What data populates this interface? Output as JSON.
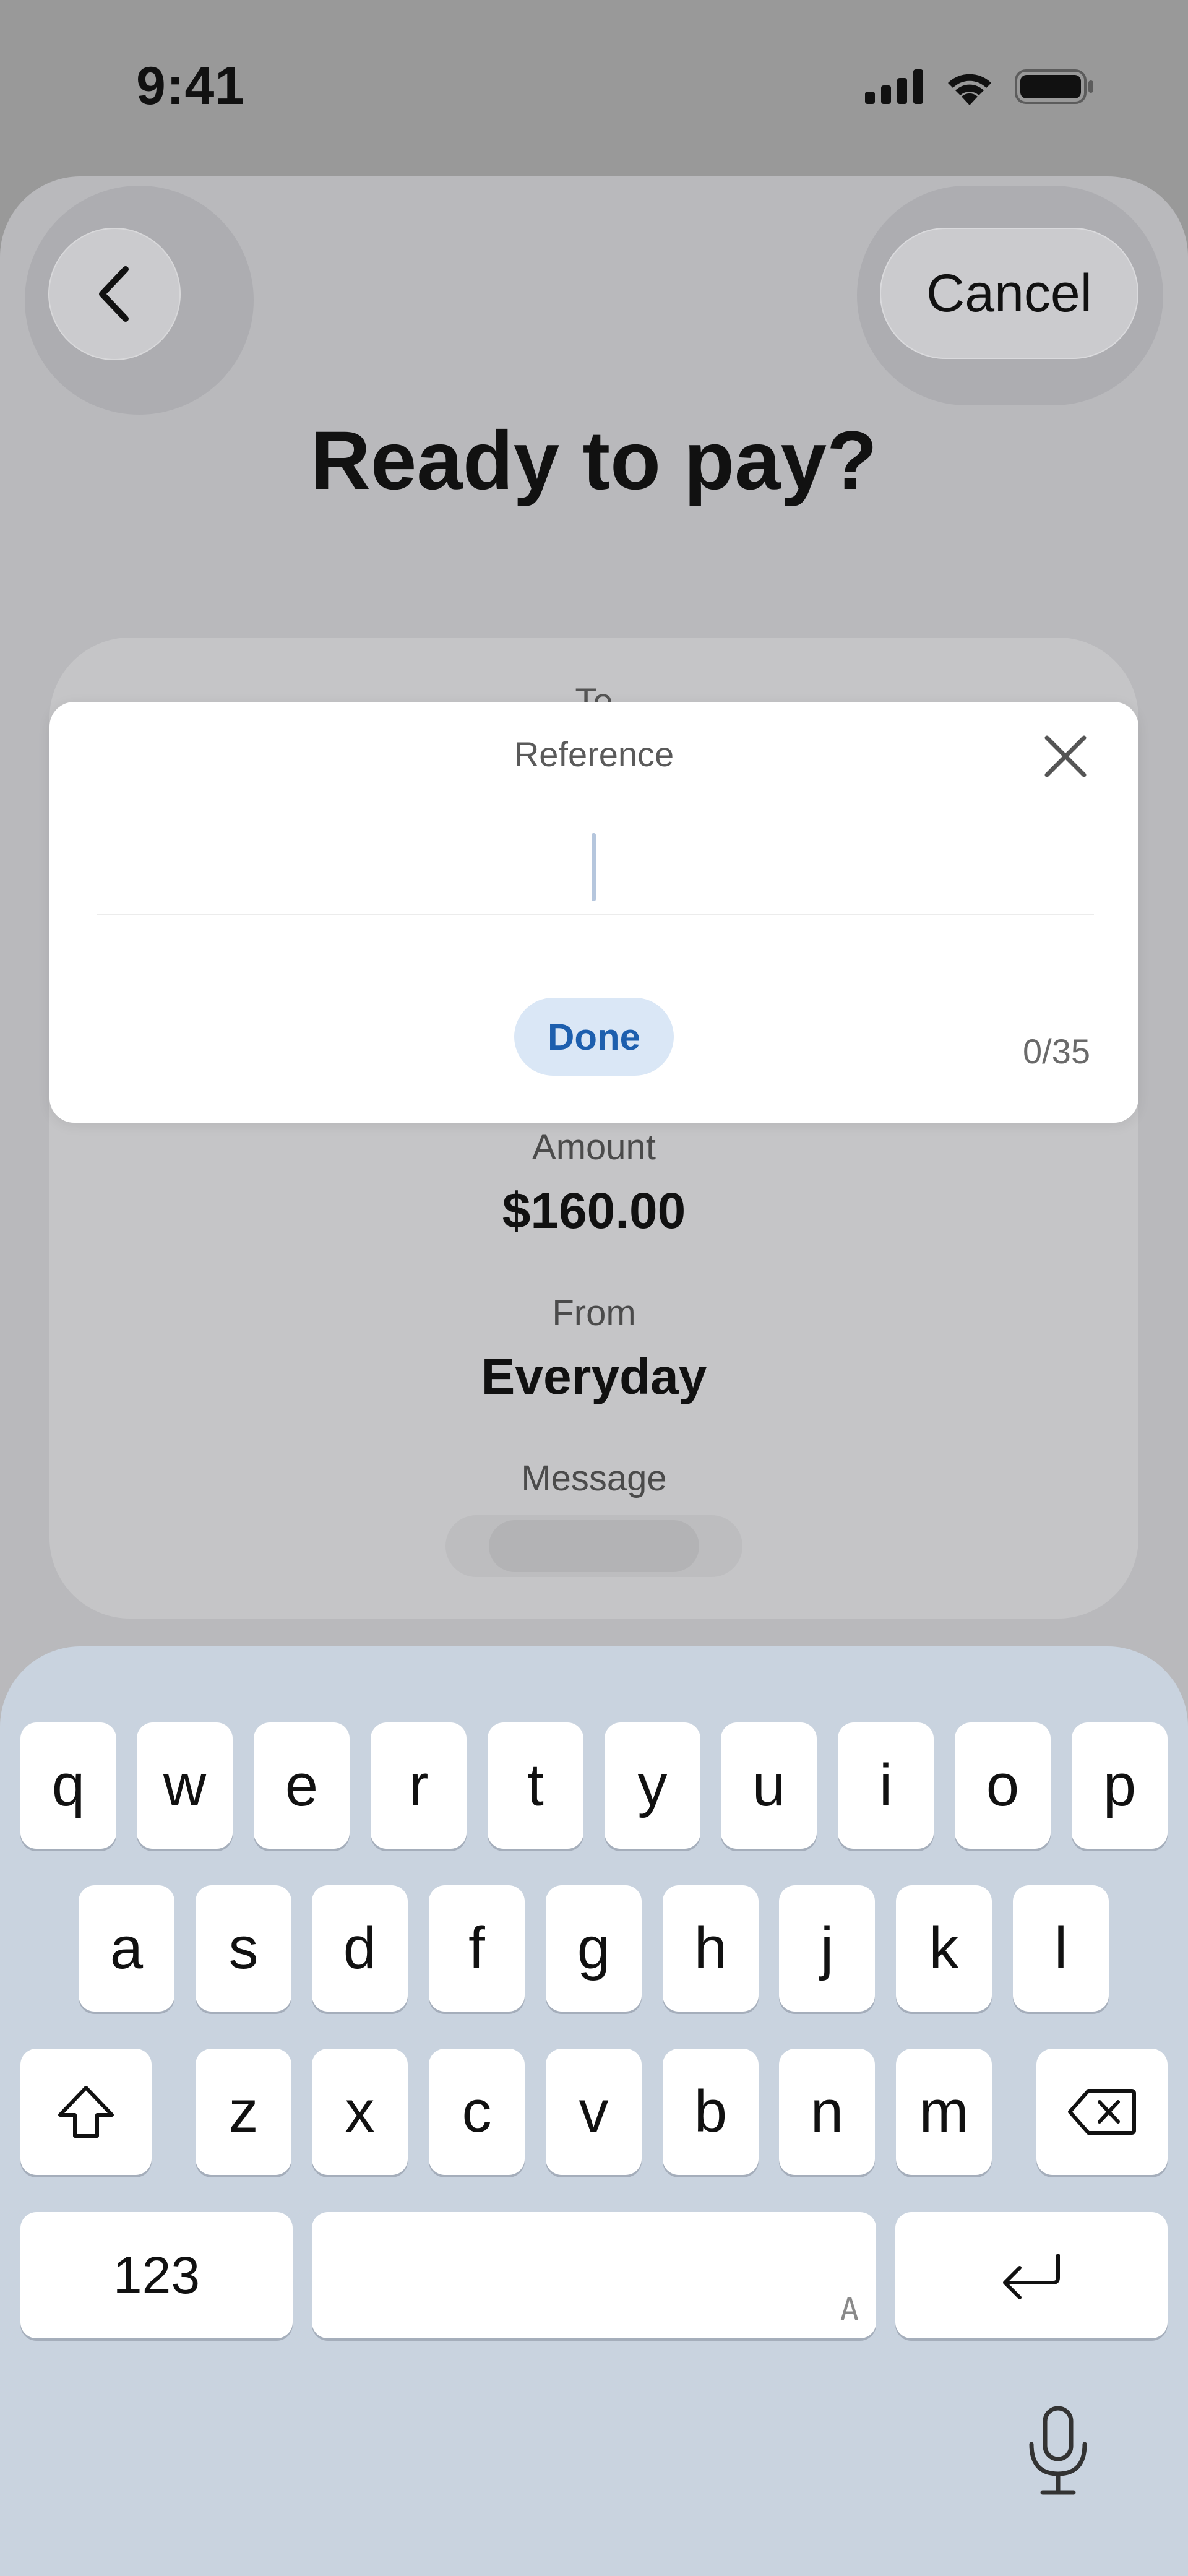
{
  "status_bar": {
    "time": "9:41"
  },
  "header": {
    "title": "Ready to pay?",
    "cancel_label": "Cancel"
  },
  "summary": {
    "to_label": "To",
    "amount_label": "Amount",
    "amount_value": "$160.00",
    "from_label": "From",
    "from_value": "Everyday",
    "message_label": "Message"
  },
  "reference_modal": {
    "title": "Reference",
    "input_value": "",
    "done_label": "Done",
    "counter": "0/35"
  },
  "keyboard": {
    "row1": [
      "q",
      "w",
      "e",
      "r",
      "t",
      "y",
      "u",
      "i",
      "o",
      "p"
    ],
    "row2": [
      "a",
      "s",
      "d",
      "f",
      "g",
      "h",
      "j",
      "k",
      "l"
    ],
    "row3": [
      "z",
      "x",
      "c",
      "v",
      "b",
      "n",
      "m"
    ],
    "numbers_label": "123",
    "space_hint": "A"
  },
  "colors": {
    "accent": "#1d5fae",
    "done_bg": "#dae7f6",
    "keyboard_bg": "#c9d3df",
    "overlay": "#999999"
  },
  "icons": {
    "back": "chevron-left-icon",
    "close": "close-icon",
    "shift": "shift-icon",
    "delete": "backspace-icon",
    "return": "return-icon",
    "mic": "microphone-icon"
  }
}
